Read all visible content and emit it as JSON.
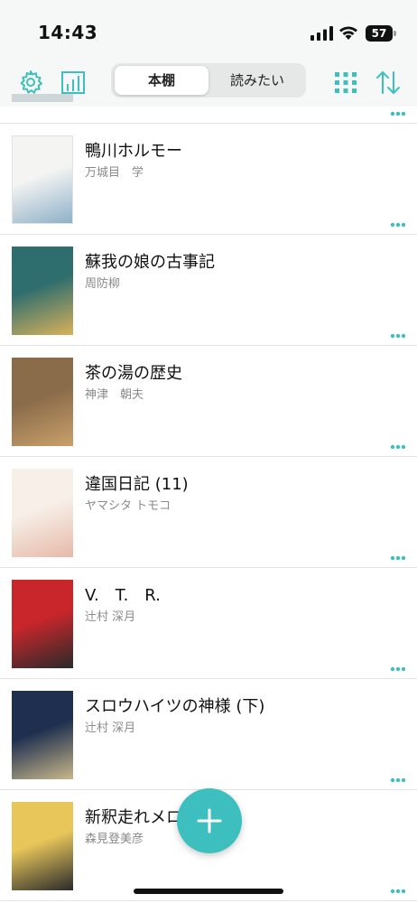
{
  "status_bar": {
    "time": "14:43",
    "battery": "57"
  },
  "toolbar": {
    "tabs": [
      {
        "label": "本棚",
        "selected": true
      },
      {
        "label": "読みたい",
        "selected": false
      }
    ],
    "icons": [
      "gear-icon",
      "stats-chart-icon",
      "grid-view-icon",
      "sort-arrows-icon"
    ]
  },
  "books": [
    {
      "title": "鴨川ホルモー",
      "author": "万城目　学",
      "cover_colors": [
        "#f4f4f2",
        "#8fb0c8"
      ]
    },
    {
      "title": "蘇我の娘の古事記",
      "author": "周防柳",
      "cover_colors": [
        "#2f6e6e",
        "#d8b25a"
      ]
    },
    {
      "title": "茶の湯の歴史",
      "author": "神津　朝夫",
      "cover_colors": [
        "#8a6b4a",
        "#c9a06a"
      ]
    },
    {
      "title": "違国日記 (11)",
      "author": "ヤマシタ トモコ",
      "cover_colors": [
        "#f7efe8",
        "#e6b9a8"
      ]
    },
    {
      "title": "V.　T.　R.",
      "author": "辻村 深月",
      "cover_colors": [
        "#c9262b",
        "#2a2a2a"
      ]
    },
    {
      "title": "スロウハイツの神様 (下)",
      "author": "辻村 深月",
      "cover_colors": [
        "#1e2f4f",
        "#c9b78a"
      ]
    },
    {
      "title": "新釈走れメロス",
      "author": "森見登美彦",
      "cover_colors": [
        "#e9c65a",
        "#2a2a2a"
      ]
    }
  ],
  "fab": {
    "icon": "plus-icon"
  },
  "colors": {
    "accent": "#3dbfbf",
    "toolbar_bg": "#f6f7f7"
  }
}
